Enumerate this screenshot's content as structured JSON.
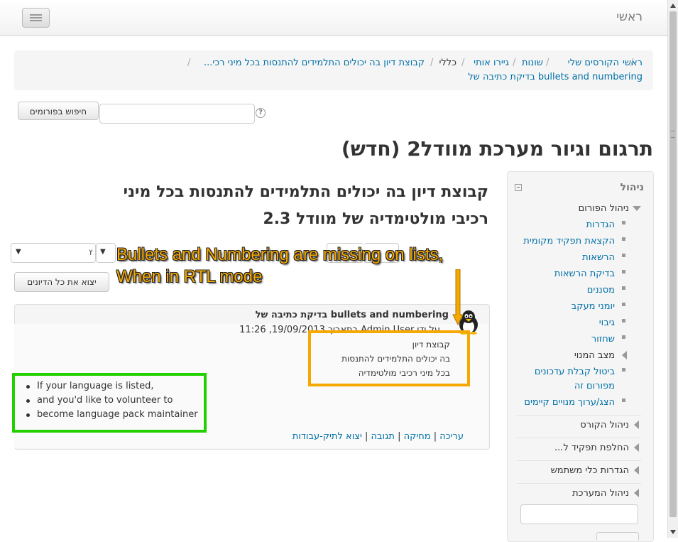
{
  "navbar": {
    "brand": "ראשי"
  },
  "breadcrumb": {
    "items": [
      "ראשי",
      "הקורסים שלי",
      "שונות",
      "גיירו אותי",
      "כללי",
      "קבוצת דיון בה יכולים התלמידים להתנסות בכל מיני רכי...",
      "בדיקת כתיבה של bullets and numbering"
    ],
    "separator": "/"
  },
  "search": {
    "button_label": "חיפוש בפורומים",
    "value": "",
    "help_icon": "question-circle-icon"
  },
  "page_title": "תרגום וגיור מערכת מוודל2 (חדש)",
  "discussion": {
    "title_line1": "קבוצת דיון בה יכולים התלמידים להתנסות בכל מיני",
    "title_line2": "רכיבי מולטימדיה של מוודל 2.3",
    "select1_value": "ץ",
    "return_button": "יצוא את כל הדיונים"
  },
  "post": {
    "subject": "בדיקת כתיבה של bullets and numbering",
    "by": "על ידי Admin User בתאריך 19/09/2013, 11:26",
    "rtl_items": [
      "קבוצת דיון",
      "בה יכולים התלמידים להתנסות",
      "בכל מיני רכיבי מולטימדיה"
    ],
    "ltr_items": [
      "If your language is listed,",
      "and you'd like to volunteer to",
      "become language pack maintainer"
    ],
    "commands": [
      "עריכה",
      "מחיקה",
      "תגובה",
      "יצוא לתיק-עבודות"
    ]
  },
  "admin": {
    "title": "ניהול",
    "forum_admin": "ניהול הפורום",
    "forum_items": [
      "הגדרות",
      "הקצאת תפקיד מקומית",
      "הרשאות",
      "בדיקת הרשאות",
      "מסננים",
      "יומני מעקב",
      "גיבוי",
      "שחזור"
    ],
    "subscription_mode": "מצב המנוי",
    "unsubscribe_line1": "ביטול קבלת עדכונים",
    "unsubscribe_line2": "מפורום זה",
    "show_subscribers": "הצג/ערוך מנויים קיימים",
    "sections": [
      "ניהול הקורס",
      "החלפת תפקיד ל...",
      "הגדרות כלי משתמש",
      "ניהול המערכת"
    ]
  },
  "annotation": {
    "line1": "Bullets and Numbering are missing on lists,",
    "line2": "When in RTL mode"
  },
  "colors": {
    "annotation": "#f5a800",
    "highlight_green": "#22d000",
    "link": "#0070a8"
  }
}
